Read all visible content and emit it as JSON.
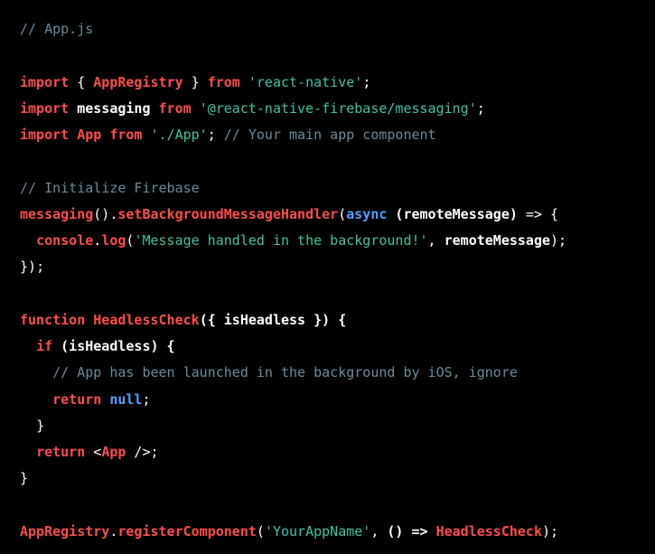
{
  "code": {
    "c1": "// App.js",
    "kw_import1": "import",
    "brace_open": "{ ",
    "appregistry": "AppRegistry",
    "brace_close": " }",
    "kw_from": "from",
    "str_reactnative": "'react-native'",
    "semi": ";",
    "messaging": "messaging",
    "str_firebase": "'@react-native-firebase/messaging'",
    "app": "App",
    "str_app": "'./App'",
    "c2": "// Your main app component",
    "c3": "// Initialize Firebase",
    "messaging_call": "messaging",
    "parens": "().",
    "setbg": "setBackgroundMessageHandler",
    "open_paren": "(",
    "async": "async",
    "remotemsg_param": " (remoteMessage) ",
    "arrow": "=>",
    "open_brace": " {",
    "console": "console",
    "dot": ".",
    "log": "log",
    "str_msghandled": "'Message handled in the background!'",
    "comma": ", ",
    "remotemsg": "remoteMessage",
    "close_paren": ")",
    "close_brace": "}",
    "kw_function": "function",
    "headlesscheck": "HeadlessCheck",
    "param_headless": "({ isHeadless }) {",
    "kw_if": "if",
    "if_cond": " (isHeadless) {",
    "c4": "// App has been launched in the background by iOS, ignore",
    "kw_return": "return",
    "null": "null",
    "jsx_open": "<",
    "jsx_app": "App",
    "jsx_close": " />",
    "regcomp": "registerComponent",
    "str_appname": "'YourAppName'",
    "arrow_fn": "() => "
  }
}
